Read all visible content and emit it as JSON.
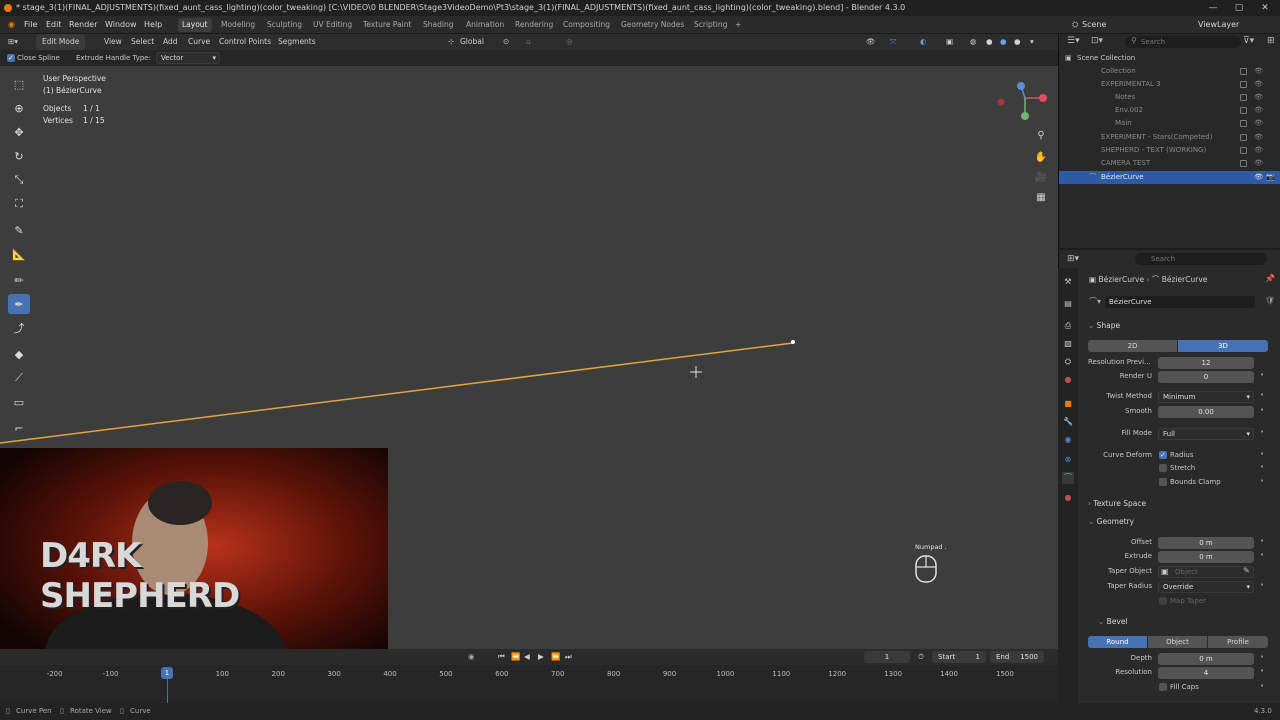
{
  "titlebar": {
    "title": "* stage_3(1)(FINAL_ADJUSTMENTS)(fixed_aunt_cass_lighting)(color_tweaking) [C:\\VIDEO\\0 BLENDER\\Stage3VideoDemo\\Pt3\\stage_3(1)(FINAL_ADJUSTMENTS)(fixed_aunt_cass_lighting)(color_tweaking).blend] - Blender 4.3.0",
    "minimize": "—",
    "maximize": "▢",
    "close": "✕"
  },
  "menubar": {
    "items": [
      "File",
      "Edit",
      "Render",
      "Window",
      "Help"
    ],
    "workspaces": [
      "Layout",
      "Modeling",
      "Sculpting",
      "UV Editing",
      "Texture Paint",
      "Shading",
      "Animation",
      "Rendering",
      "Compositing",
      "Geometry Nodes",
      "Scripting"
    ],
    "add_workspace": "+",
    "scene": "Scene",
    "view_layer": "ViewLayer"
  },
  "viewport_header": {
    "mode": "Edit Mode",
    "menus": [
      "View",
      "Select",
      "Add",
      "Curve",
      "Control Points",
      "Segments"
    ],
    "transform_orientation": "Global"
  },
  "tool_header": {
    "close_spline_label": "Close Spline",
    "extrude_handle_label": "Extrude Handle Type:",
    "extrude_handle_value": "Vector"
  },
  "viewport": {
    "view_name": "User Perspective",
    "object_name": "(1) BézierCurve",
    "objects_label": "Objects",
    "objects_value": "1 / 1",
    "vertices_label": "Vertices",
    "vertices_value": "1 / 15",
    "numpad_label": "Numpad ."
  },
  "webcam": {
    "logo_text": "D4RK SHEPHERD"
  },
  "timeline": {
    "current_frame": "1",
    "start_label": "Start",
    "start_value": "1",
    "end_label": "End",
    "end_value": "1500",
    "ticks": [
      "-200",
      "-100",
      "1",
      "100",
      "200",
      "300",
      "400",
      "500",
      "600",
      "700",
      "800",
      "900",
      "1000",
      "1100",
      "1200",
      "1300",
      "1400",
      "1500"
    ],
    "playhead_frame": 1
  },
  "statusbar": {
    "items": [
      "Curve Pen",
      "Rotate View",
      "Curve"
    ],
    "version": "4.3.0"
  },
  "outliner": {
    "search_placeholder": "Search",
    "root": "Scene Collection",
    "rows": [
      {
        "label": "Collection"
      },
      {
        "label": "EXPERIMENTAL 3"
      },
      {
        "label": "Notes"
      },
      {
        "label": "Env.002"
      },
      {
        "label": "Main"
      },
      {
        "label": "EXPERIMENT - Stars(Competed)"
      },
      {
        "label": "SHEPHERD - TEXT (WORKING)"
      },
      {
        "label": "CAMERA TEST"
      },
      {
        "label": "BézierCurve"
      }
    ]
  },
  "properties": {
    "search_placeholder": "Search",
    "breadcrumb_object": "BézierCurve",
    "breadcrumb_data": "BézierCurve",
    "datablock": "BézierCurve",
    "shape": {
      "header": "Shape",
      "mode_2d": "2D",
      "mode_3d": "3D",
      "resolution_preview_label": "Resolution Previ...",
      "resolution_preview_value": "12",
      "render_u_label": "Render U",
      "render_u_value": "0",
      "twist_method_label": "Twist Method",
      "twist_method_value": "Minimum",
      "smooth_label": "Smooth",
      "smooth_value": "0.00",
      "fill_mode_label": "Fill Mode",
      "fill_mode_value": "Full",
      "curve_deform_label": "Curve Deform",
      "radius_label": "Radius",
      "stretch_label": "Stretch",
      "bounds_clamp_label": "Bounds Clamp"
    },
    "texture_space_header": "Texture Space",
    "geometry": {
      "header": "Geometry",
      "offset_label": "Offset",
      "offset_value": "0 m",
      "extrude_label": "Extrude",
      "extrude_value": "0 m",
      "taper_object_label": "Taper Object",
      "taper_object_placeholder": "Object",
      "taper_radius_label": "Taper Radius",
      "taper_radius_value": "Override",
      "map_taper_label": "Map Taper"
    },
    "bevel": {
      "header": "Bevel",
      "mode_round": "Round",
      "mode_object": "Object",
      "mode_profile": "Profile",
      "depth_label": "Depth",
      "depth_value": "0 m",
      "resolution_label": "Resolution",
      "resolution_value": "4",
      "fill_caps_label": "Fill Caps"
    }
  },
  "colors": {
    "accent": "#4772b3",
    "curve": "#e8a33c",
    "viewport_bg": "#3d3d3d"
  }
}
